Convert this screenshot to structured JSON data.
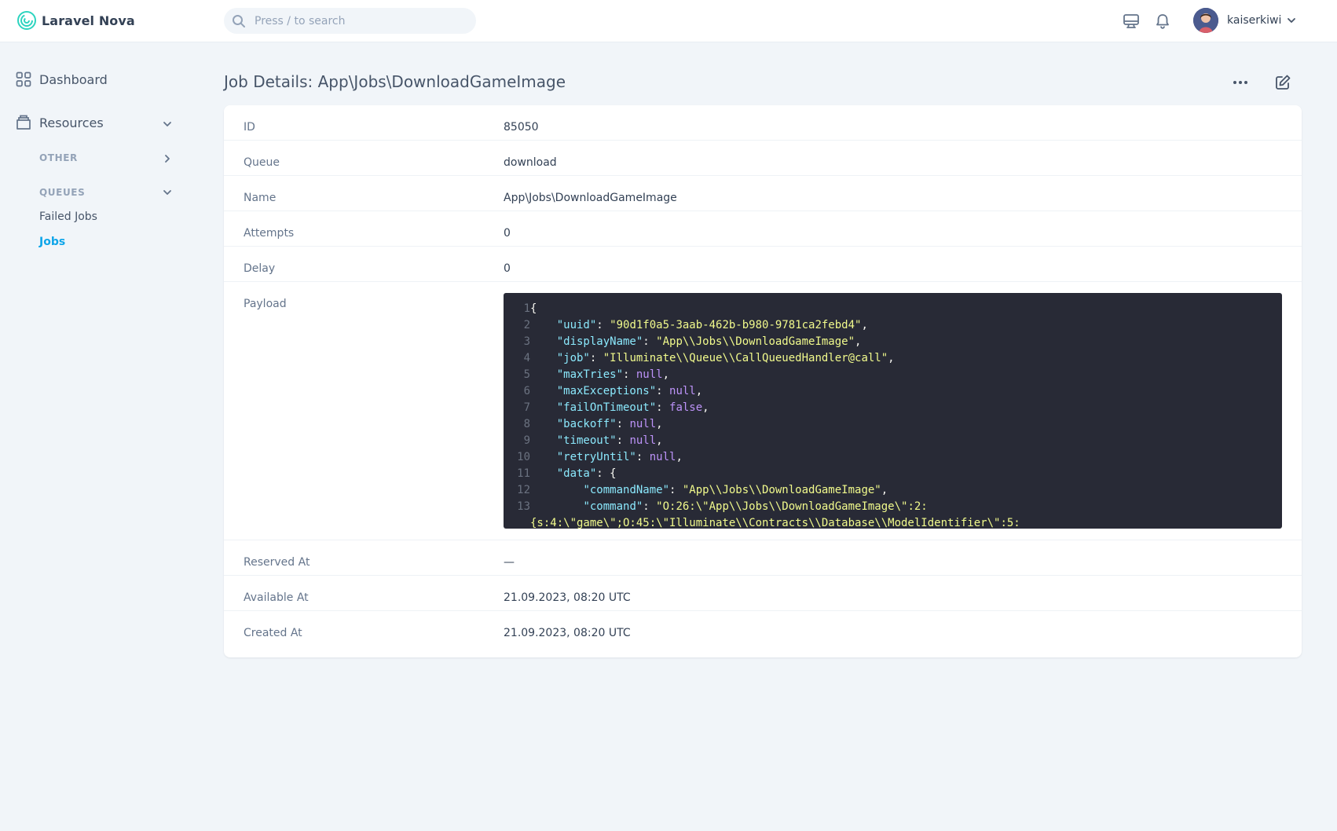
{
  "app": {
    "name": "Laravel Nova"
  },
  "search": {
    "placeholder": "Press / to search"
  },
  "user": {
    "name": "kaiserkiwi"
  },
  "sidebar": {
    "dashboard": "Dashboard",
    "resources": "Resources",
    "other": "OTHER",
    "queues": "QUEUES",
    "failed_jobs": "Failed Jobs",
    "jobs": "Jobs"
  },
  "page": {
    "title": "Job Details: App\\Jobs\\DownloadGameImage"
  },
  "fields": {
    "id": {
      "label": "ID",
      "value": "85050"
    },
    "queue": {
      "label": "Queue",
      "value": "download"
    },
    "name": {
      "label": "Name",
      "value": "App\\Jobs\\DownloadGameImage"
    },
    "attempts": {
      "label": "Attempts",
      "value": "0"
    },
    "delay": {
      "label": "Delay",
      "value": "0"
    },
    "payload": {
      "label": "Payload"
    },
    "reserved_at": {
      "label": "Reserved At",
      "value": "—"
    },
    "available_at": {
      "label": "Available At",
      "value": "21.09.2023, 08:20 UTC"
    },
    "created_at": {
      "label": "Created At",
      "value": "21.09.2023, 08:20 UTC"
    }
  },
  "payload_lines": [
    {
      "n": "1",
      "parts": [
        {
          "t": "p",
          "v": "{"
        }
      ]
    },
    {
      "n": "2",
      "parts": [
        {
          "t": "p",
          "v": "    "
        },
        {
          "t": "k",
          "v": "\"uuid\""
        },
        {
          "t": "p",
          "v": ": "
        },
        {
          "t": "s",
          "v": "\"90d1f0a5-3aab-462b-b980-9781ca2febd4\""
        },
        {
          "t": "p",
          "v": ","
        }
      ]
    },
    {
      "n": "3",
      "parts": [
        {
          "t": "p",
          "v": "    "
        },
        {
          "t": "k",
          "v": "\"displayName\""
        },
        {
          "t": "p",
          "v": ": "
        },
        {
          "t": "s",
          "v": "\"App\\\\Jobs\\\\DownloadGameImage\""
        },
        {
          "t": "p",
          "v": ","
        }
      ]
    },
    {
      "n": "4",
      "parts": [
        {
          "t": "p",
          "v": "    "
        },
        {
          "t": "k",
          "v": "\"job\""
        },
        {
          "t": "p",
          "v": ": "
        },
        {
          "t": "s",
          "v": "\"Illuminate\\\\Queue\\\\CallQueuedHandler@call\""
        },
        {
          "t": "p",
          "v": ","
        }
      ]
    },
    {
      "n": "5",
      "parts": [
        {
          "t": "p",
          "v": "    "
        },
        {
          "t": "k",
          "v": "\"maxTries\""
        },
        {
          "t": "p",
          "v": ": "
        },
        {
          "t": "n",
          "v": "null"
        },
        {
          "t": "p",
          "v": ","
        }
      ]
    },
    {
      "n": "6",
      "parts": [
        {
          "t": "p",
          "v": "    "
        },
        {
          "t": "k",
          "v": "\"maxExceptions\""
        },
        {
          "t": "p",
          "v": ": "
        },
        {
          "t": "n",
          "v": "null"
        },
        {
          "t": "p",
          "v": ","
        }
      ]
    },
    {
      "n": "7",
      "parts": [
        {
          "t": "p",
          "v": "    "
        },
        {
          "t": "k",
          "v": "\"failOnTimeout\""
        },
        {
          "t": "p",
          "v": ": "
        },
        {
          "t": "n",
          "v": "false"
        },
        {
          "t": "p",
          "v": ","
        }
      ]
    },
    {
      "n": "8",
      "parts": [
        {
          "t": "p",
          "v": "    "
        },
        {
          "t": "k",
          "v": "\"backoff\""
        },
        {
          "t": "p",
          "v": ": "
        },
        {
          "t": "n",
          "v": "null"
        },
        {
          "t": "p",
          "v": ","
        }
      ]
    },
    {
      "n": "9",
      "parts": [
        {
          "t": "p",
          "v": "    "
        },
        {
          "t": "k",
          "v": "\"timeout\""
        },
        {
          "t": "p",
          "v": ": "
        },
        {
          "t": "n",
          "v": "null"
        },
        {
          "t": "p",
          "v": ","
        }
      ]
    },
    {
      "n": "10",
      "parts": [
        {
          "t": "p",
          "v": "    "
        },
        {
          "t": "k",
          "v": "\"retryUntil\""
        },
        {
          "t": "p",
          "v": ": "
        },
        {
          "t": "n",
          "v": "null"
        },
        {
          "t": "p",
          "v": ","
        }
      ]
    },
    {
      "n": "11",
      "parts": [
        {
          "t": "p",
          "v": "    "
        },
        {
          "t": "k",
          "v": "\"data\""
        },
        {
          "t": "p",
          "v": ": {"
        }
      ]
    },
    {
      "n": "12",
      "parts": [
        {
          "t": "p",
          "v": "        "
        },
        {
          "t": "k",
          "v": "\"commandName\""
        },
        {
          "t": "p",
          "v": ": "
        },
        {
          "t": "s",
          "v": "\"App\\\\Jobs\\\\DownloadGameImage\""
        },
        {
          "t": "p",
          "v": ","
        }
      ]
    },
    {
      "n": "13",
      "parts": [
        {
          "t": "p",
          "v": "        "
        },
        {
          "t": "k",
          "v": "\"command\""
        },
        {
          "t": "p",
          "v": ": "
        },
        {
          "t": "s",
          "v": "\"O:26:\\\"App\\\\Jobs\\\\DownloadGameImage\\\":2:"
        }
      ]
    },
    {
      "n": "",
      "parts": [
        {
          "t": "s",
          "v": "{s:4:\\\"game\\\";O:45:\\\"Illuminate\\\\Contracts\\\\Database\\\\ModelIdentifier\\\":5:"
        }
      ]
    }
  ]
}
